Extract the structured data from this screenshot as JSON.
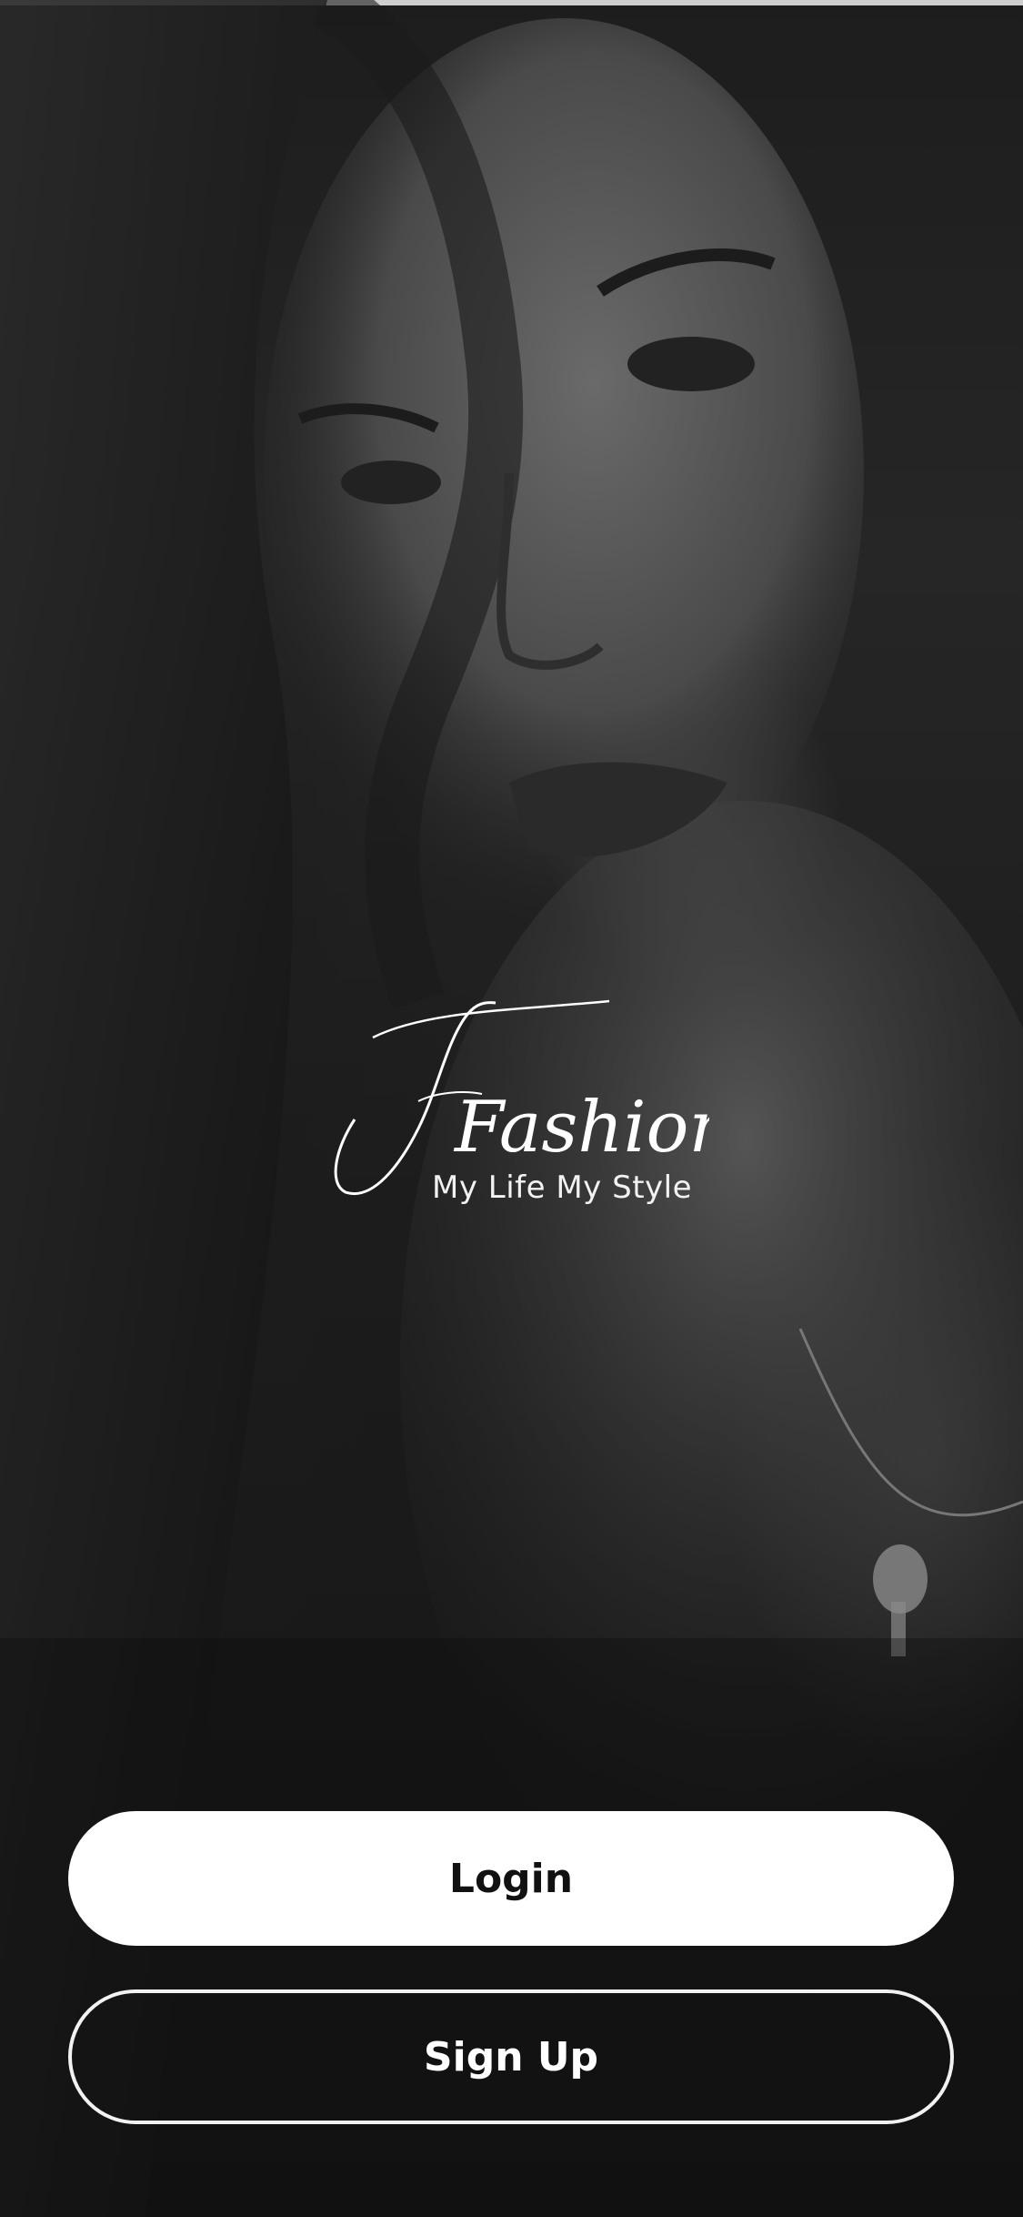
{
  "brand": {
    "logo_text": "Fashions",
    "tagline": "My Life My Style"
  },
  "actions": {
    "login_label": "Login",
    "signup_label": "Sign Up"
  },
  "theme": {
    "button_primary_bg": "#ffffff",
    "button_primary_text": "#111111",
    "button_outline_border": "#f2f2f2"
  },
  "background": {
    "subject": "monochrome portrait photo"
  }
}
